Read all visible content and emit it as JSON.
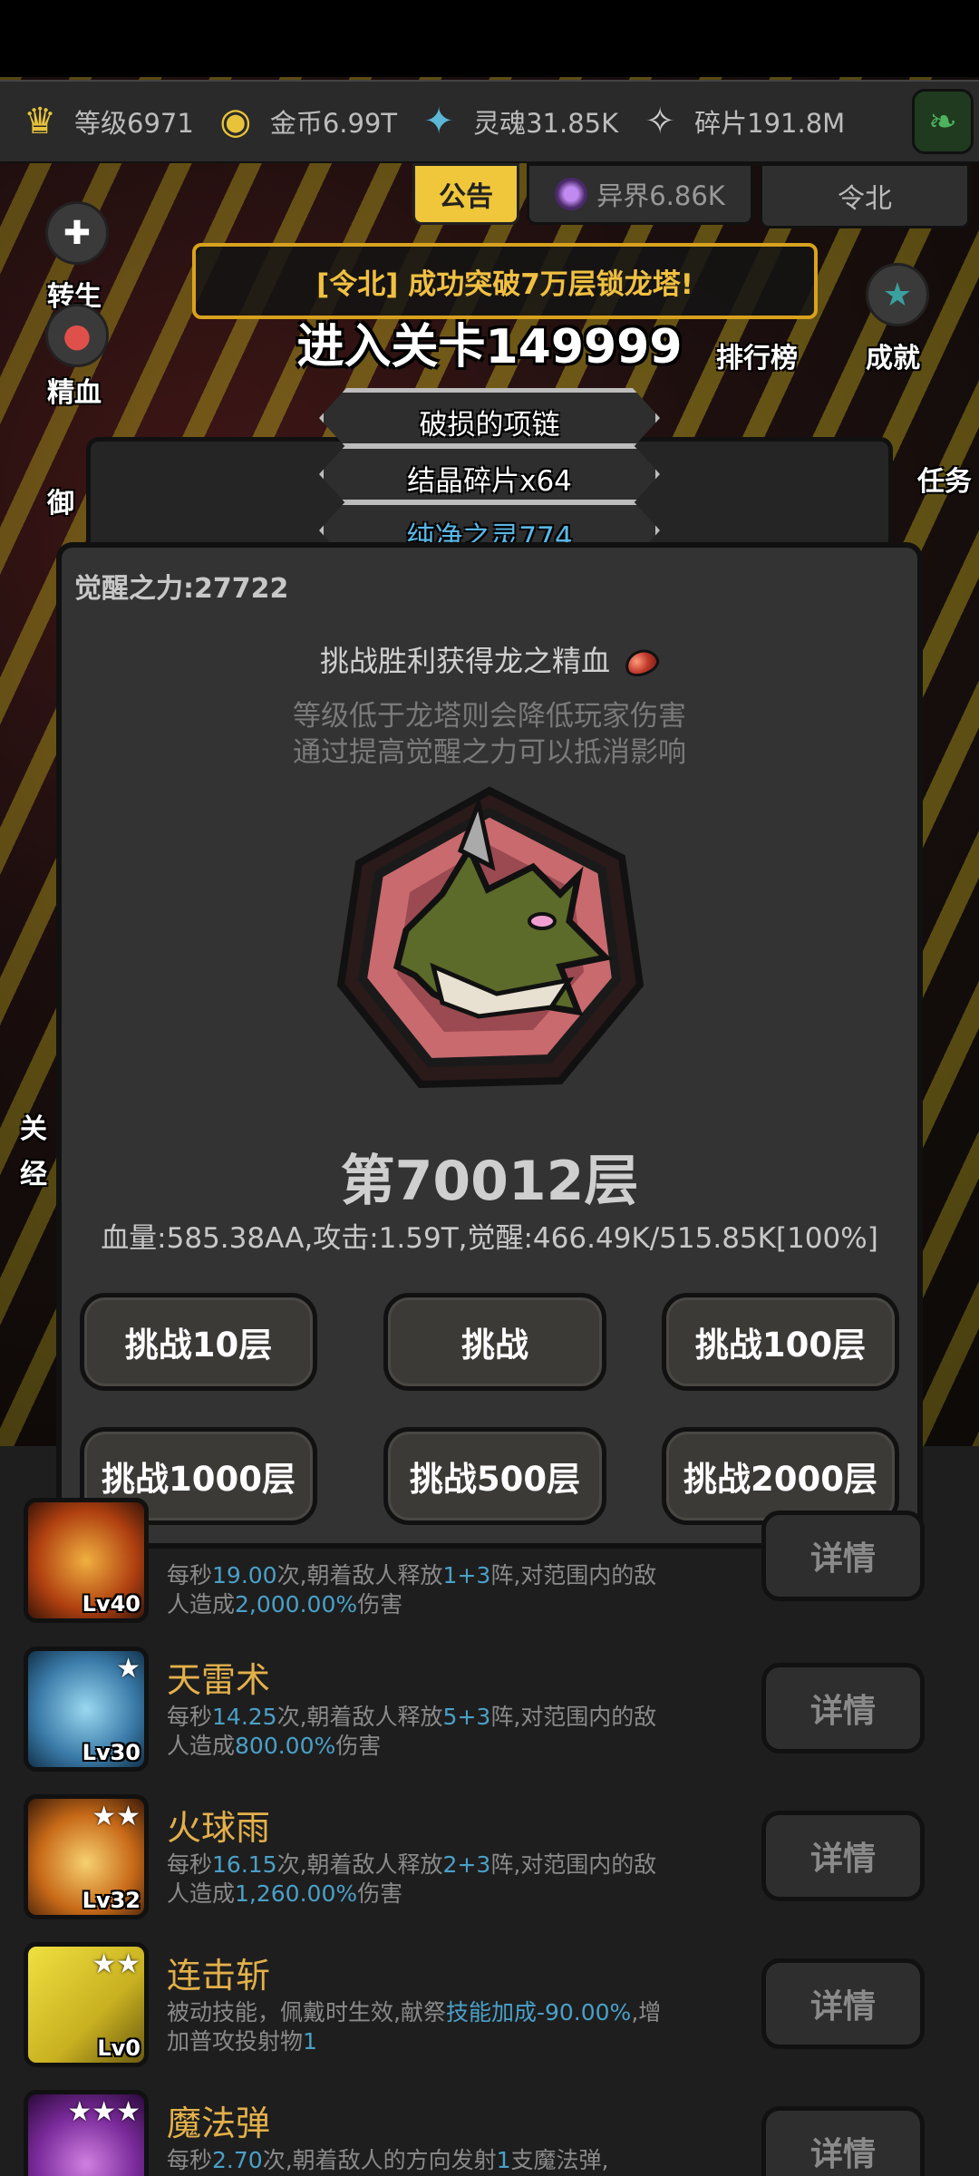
{
  "resources": [
    {
      "icon": "crown-icon",
      "glyph": "♛",
      "color": "#e8c33a",
      "value": "等级6971"
    },
    {
      "icon": "coin-icon",
      "glyph": "◉",
      "color": "#e8c33a",
      "value": "金币6.99T"
    },
    {
      "icon": "soul-icon",
      "glyph": "✦",
      "color": "#5ab7d6",
      "value": "灵魂31.85K"
    },
    {
      "icon": "shard-icon",
      "glyph": "✧",
      "color": "#d0d0d0",
      "value": "碎片191.8M"
    }
  ],
  "tabs": {
    "notice": "公告",
    "otherworld": "异界6.86K",
    "player": "令北"
  },
  "side_labels": {
    "rebirth": "转生",
    "blood": "精血",
    "defense_partial": "御",
    "ranking": "排行榜",
    "achievement": "成就",
    "task_partial": "任务",
    "level_partial": "关",
    "exp_partial": "经"
  },
  "banner_text": "[令北] 成功突破7万层锁龙塔!",
  "stage_title": "进入关卡149999",
  "loot_items": [
    "破损的项链",
    "结晶碎片x64",
    "纯净之灵774"
  ],
  "modal": {
    "awakening_power": "觉醒之力:27722",
    "reward_text": "挑战胜利获得龙之精血",
    "hint_line1": "等级低于龙塔则会降低玩家伤害",
    "hint_line2": "通过提高觉醒之力可以抵消影响",
    "floor": "第70012层",
    "stats": "血量:585.38AA,攻击:1.59T,觉醒:466.49K/515.85K[100%]",
    "buttons": {
      "challenge_10": "挑战10层",
      "challenge": "挑战",
      "challenge_100": "挑战100层",
      "challenge_1000": "挑战1000层",
      "challenge_500": "挑战500层",
      "challenge_2000": "挑战2000层"
    }
  },
  "skills": [
    {
      "name": "",
      "level": "Lv40",
      "desc_parts": [
        "每秒",
        "19.00",
        "次,朝着敌人释放",
        "1+3",
        "阵,对范围内的敌人造成",
        "2,000.00%",
        "伤害"
      ],
      "detail": "详情"
    },
    {
      "name": "天雷术",
      "level": "Lv30",
      "desc_parts": [
        "每秒",
        "14.25",
        "次,朝着敌人释放",
        "5+3",
        "阵,对范围内的敌人造成",
        "800.00%",
        "伤害"
      ],
      "detail": "详情"
    },
    {
      "name": "火球雨",
      "level": "Lv32",
      "desc_parts": [
        "每秒",
        "16.15",
        "次,朝着敌人释放",
        "2+3",
        "阵,对范围内的敌人造成",
        "1,260.00%",
        "伤害"
      ],
      "detail": "详情"
    },
    {
      "name": "连击斩",
      "level": "Lv0",
      "desc_parts": [
        "被动技能，佩戴时生效,献祭",
        "技能加成-90.00%",
        ",增加普攻投射物",
        "1",
        ""
      ],
      "detail": "详情"
    },
    {
      "name": "魔法弹",
      "level": "",
      "desc_parts": [
        "每秒",
        "2.70",
        "次,朝着敌人的方向发射",
        "1",
        "支魔法弹,"
      ],
      "detail": "详情"
    }
  ]
}
